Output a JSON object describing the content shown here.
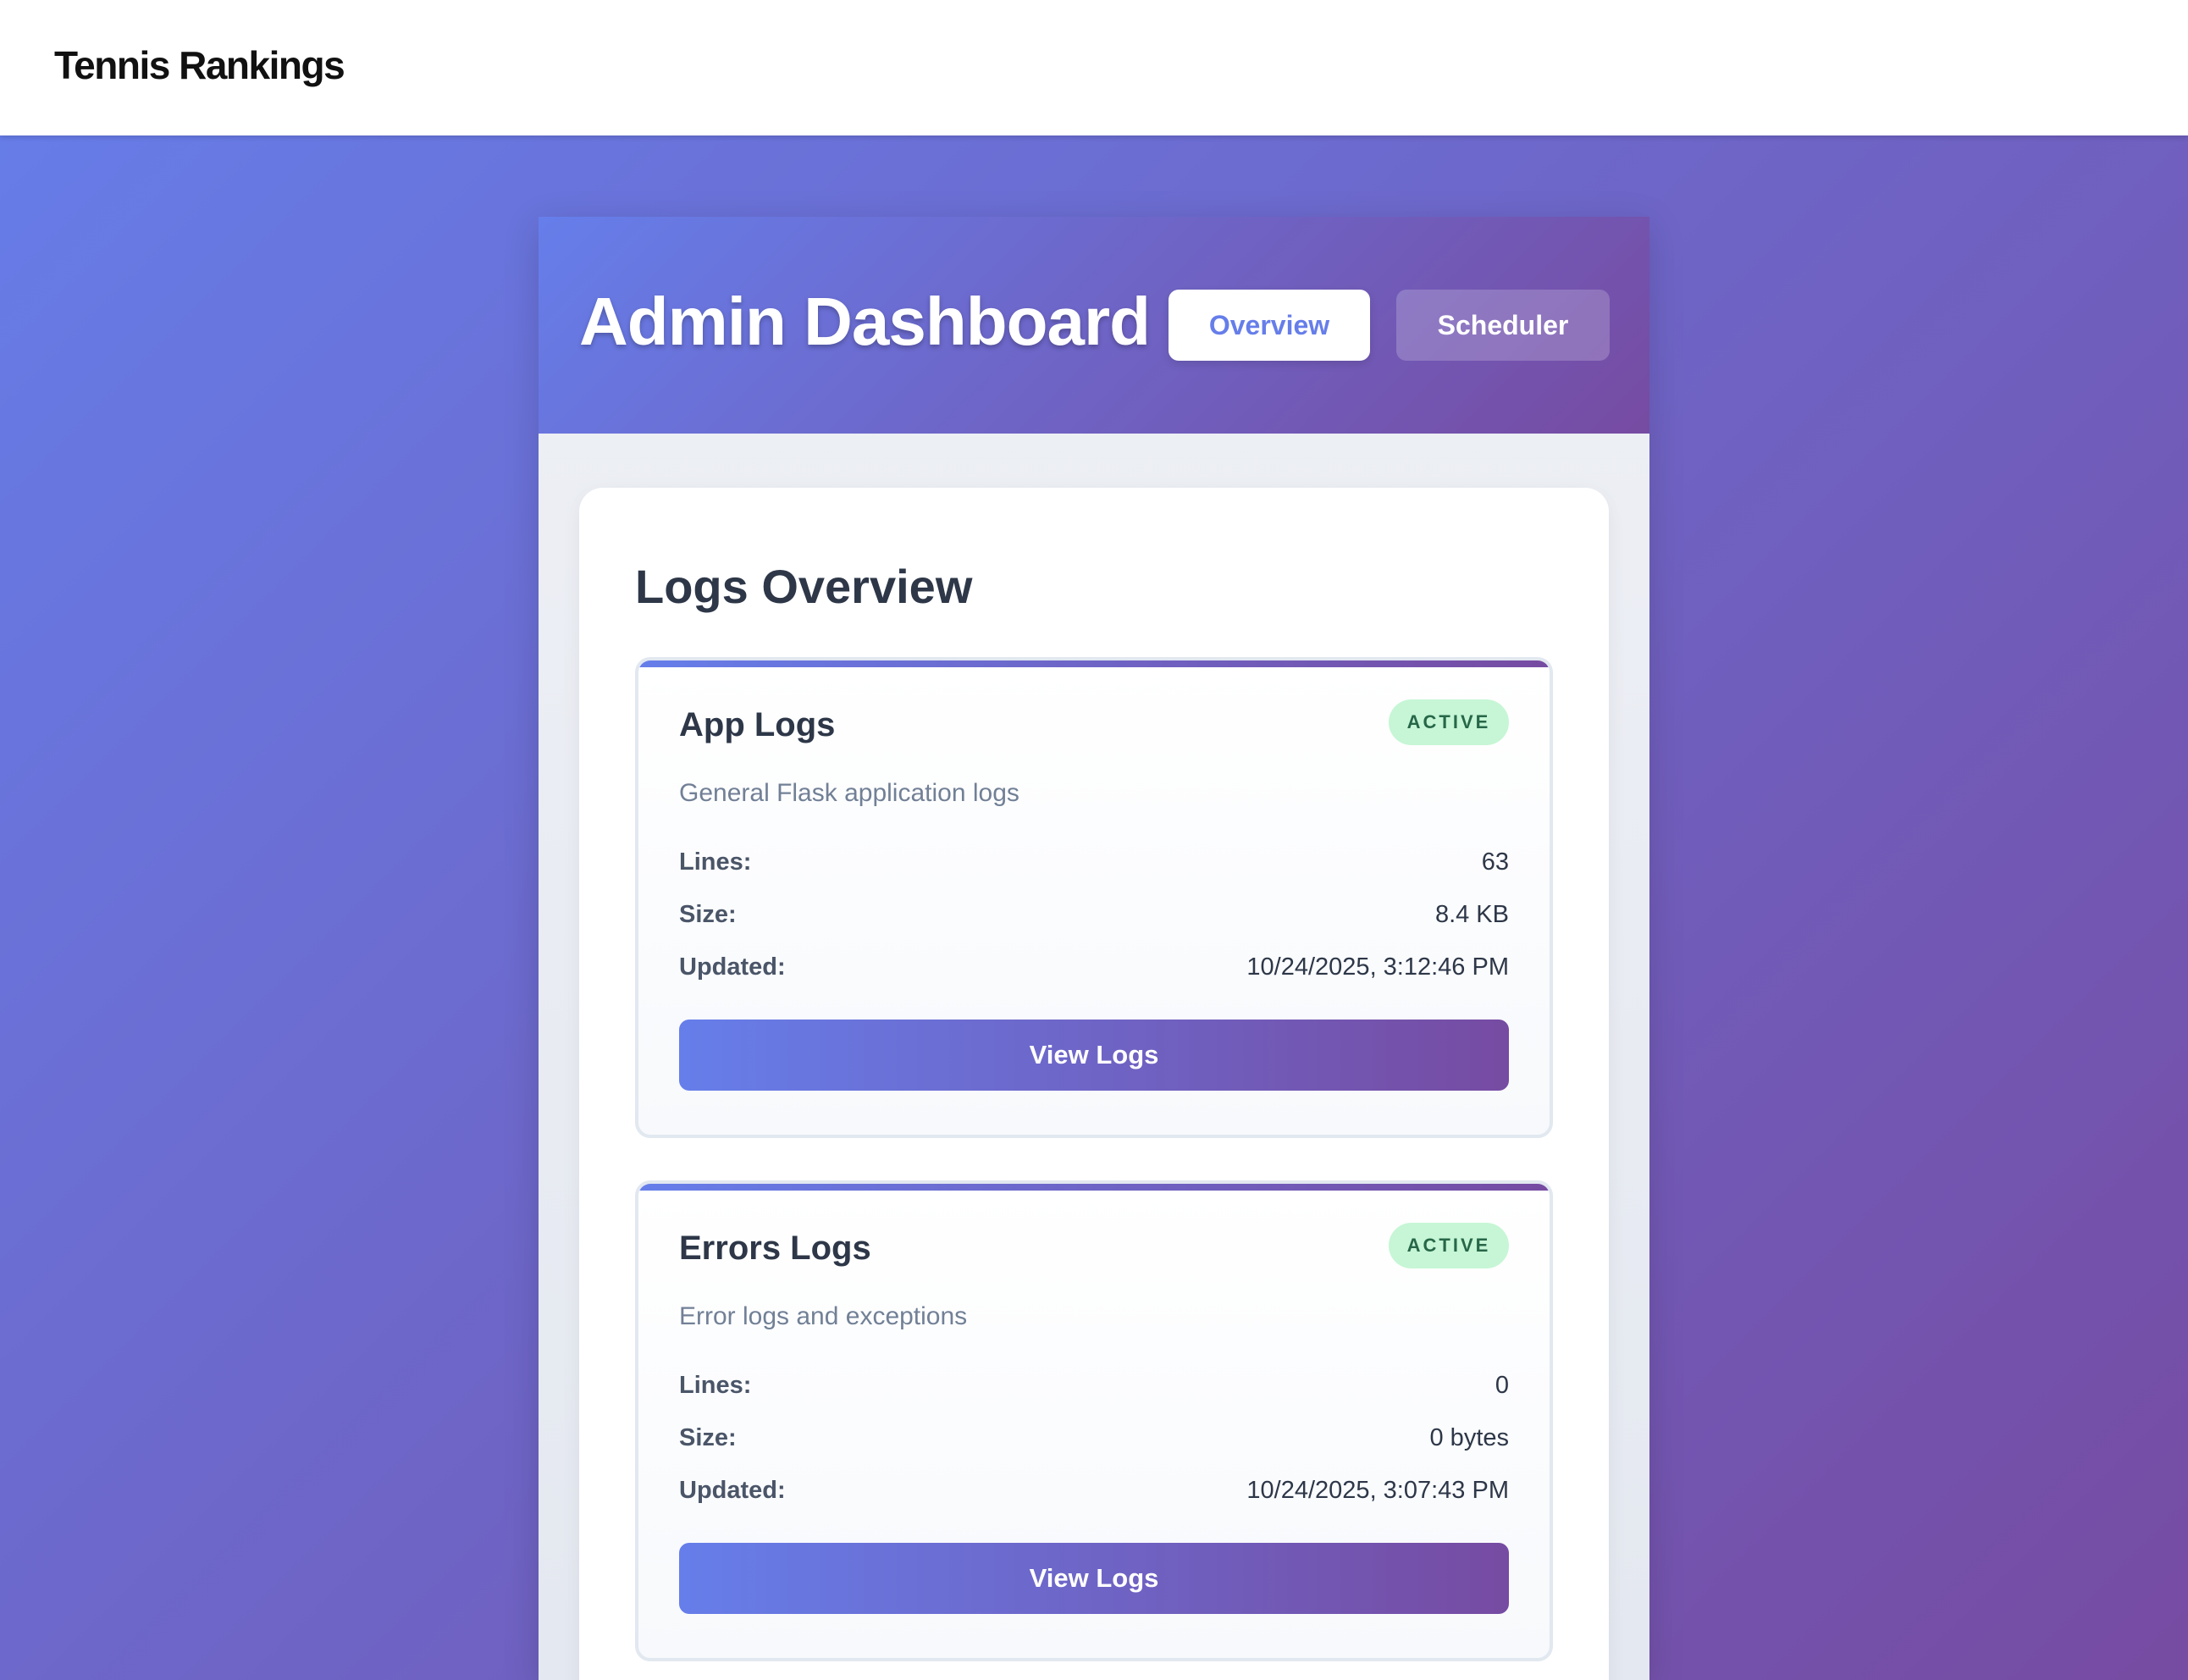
{
  "app": {
    "brand": "Tennis Rankings"
  },
  "dashboard": {
    "title": "Admin Dashboard",
    "tabs": [
      {
        "label": "Overview",
        "active": true
      },
      {
        "label": "Scheduler",
        "active": false
      }
    ]
  },
  "logs_overview": {
    "title": "Logs Overview",
    "cards": [
      {
        "name": "App Logs",
        "status": "ACTIVE",
        "description": "General Flask application logs",
        "stats": [
          {
            "label": "Lines:",
            "value": "63"
          },
          {
            "label": "Size:",
            "value": "8.4 KB"
          },
          {
            "label": "Updated:",
            "value": "10/24/2025, 3:12:46 PM"
          }
        ],
        "button": "View Logs"
      },
      {
        "name": "Errors Logs",
        "status": "ACTIVE",
        "description": "Error logs and exceptions",
        "stats": [
          {
            "label": "Lines:",
            "value": "0"
          },
          {
            "label": "Size:",
            "value": "0 bytes"
          },
          {
            "label": "Updated:",
            "value": "10/24/2025, 3:07:43 PM"
          }
        ],
        "button": "View Logs"
      }
    ]
  },
  "colors": {
    "gradient_start": "#667eea",
    "gradient_end": "#764ba2",
    "badge_bg": "#c6f6d5",
    "badge_text": "#276749"
  }
}
